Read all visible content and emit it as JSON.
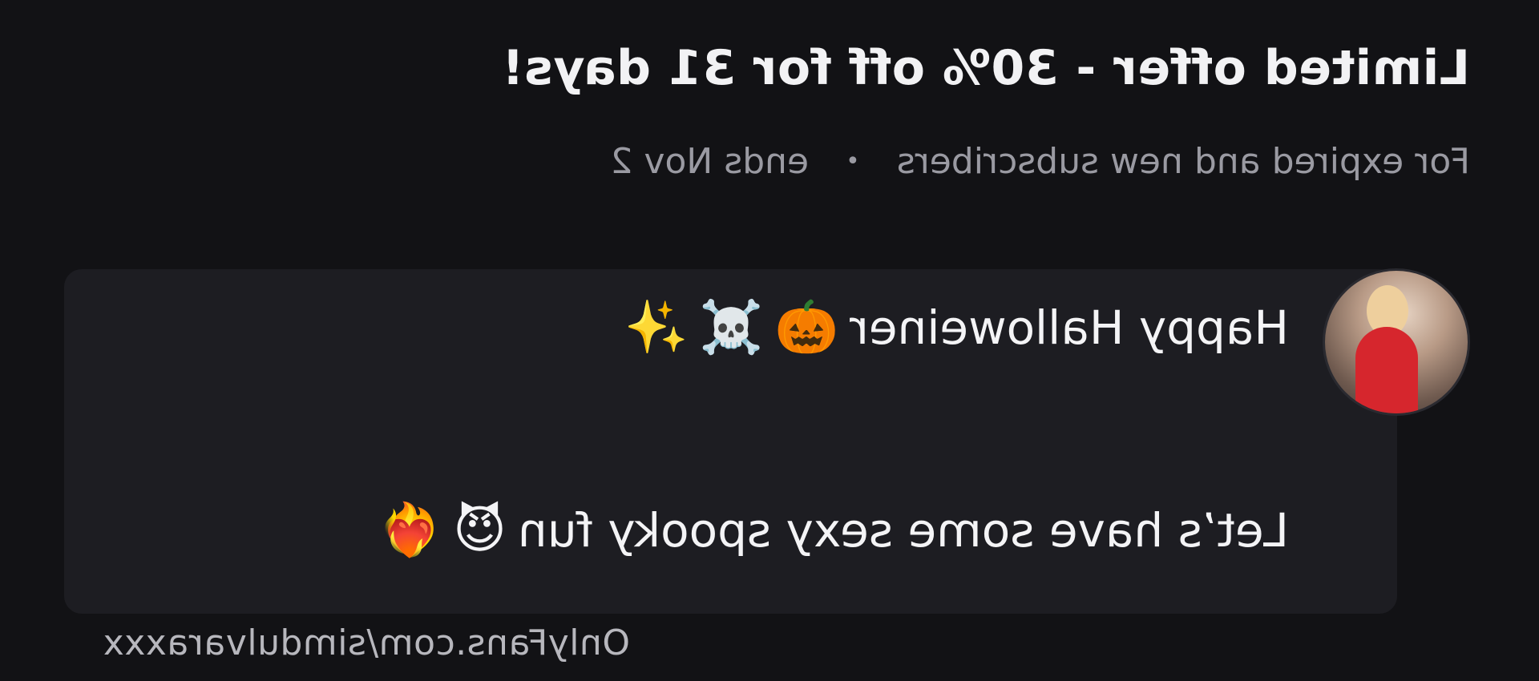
{
  "offer": {
    "title": "Limited offer - 30% off for 31 days!",
    "audience": "For expired and new subscribers",
    "separator": "•",
    "ends": "ends Nov 2"
  },
  "message": {
    "line1_text": "Happy Halloweiner",
    "line1_emojis": [
      "🎃",
      "☠️",
      "✨"
    ],
    "line2_text": "Let’s have some sexy spooky fun",
    "line2_emojis": [
      "😈",
      "❤️‍🔥"
    ]
  },
  "watermark": "OnlyFans.com/simdulvaraxxx",
  "colors": {
    "background": "#121215",
    "card": "#1d1d22",
    "title_text": "#f2f2f4",
    "subtitle_text": "#9a9aa2"
  },
  "mirrored": true
}
